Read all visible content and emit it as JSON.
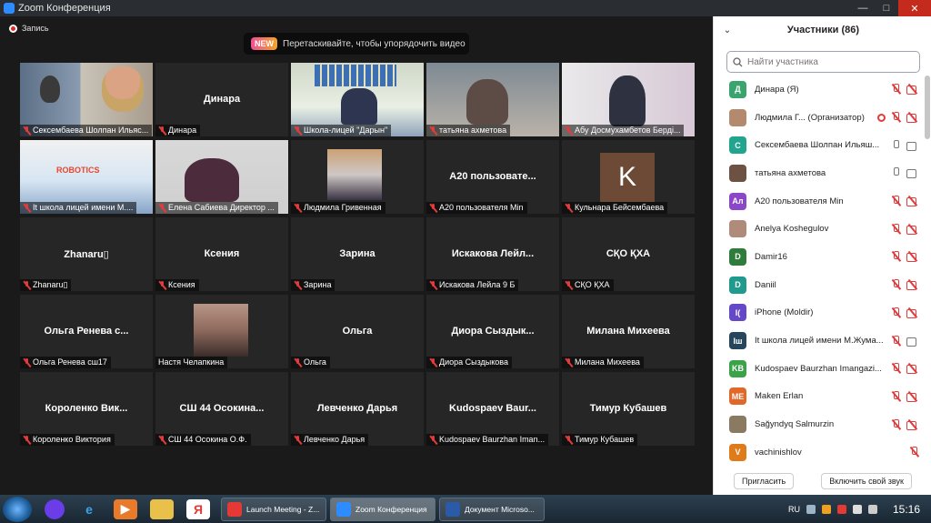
{
  "window": {
    "title": "Zoom Конференция",
    "min": "—",
    "max": "□",
    "close": "✕"
  },
  "recording": {
    "label": "Запись"
  },
  "banner": {
    "badge": "NEW",
    "text": "Перетаскивайте, чтобы упорядочить видео"
  },
  "tiles": [
    {
      "big": "",
      "caption": "Сексембаева Шолпан Ильяс...",
      "kind": "video1",
      "active": true
    },
    {
      "big": "Динара",
      "caption": "Динара",
      "kind": "name"
    },
    {
      "big": "",
      "caption": "Школа-лицей \"Дарын\"",
      "kind": "video3"
    },
    {
      "big": "",
      "caption": "татьяна ахметова",
      "kind": "video4"
    },
    {
      "big": "",
      "caption": "Абу Досмухамбетов Берді...",
      "kind": "video5"
    },
    {
      "big": "",
      "caption": "It школа лицей имени М....",
      "kind": "video6"
    },
    {
      "big": "",
      "caption": "Елена Сабиева Директор ...",
      "kind": "video7"
    },
    {
      "big": "",
      "caption": "Людмила Гривенная",
      "kind": "photo-lg"
    },
    {
      "big": "А20 пользовате...",
      "caption": "А20 пользователя Min",
      "kind": "name"
    },
    {
      "big": "",
      "caption": "Кульнара Бейсембаева",
      "kind": "k"
    },
    {
      "big": "Zhanaru▯",
      "caption": "Zhanaru▯",
      "kind": "name"
    },
    {
      "big": "Ксения",
      "caption": "Ксения",
      "kind": "name"
    },
    {
      "big": "Зарина",
      "caption": "Зарина",
      "kind": "name"
    },
    {
      "big": "Искакова Лейл...",
      "caption": "Искакова Лейла 9 Б",
      "kind": "name"
    },
    {
      "big": "СҚО ҚХА",
      "caption": "СҚО ҚХА",
      "kind": "name"
    },
    {
      "big": "Ольга Ренева с...",
      "caption": "Ольга Ренева сш17",
      "kind": "name"
    },
    {
      "big": "",
      "caption": "Настя Челапкина",
      "kind": "photo-ns",
      "nomic": true
    },
    {
      "big": "Ольга",
      "caption": "Ольга",
      "kind": "name"
    },
    {
      "big": "Диора Сыздык...",
      "caption": "Диора Сыздыкова",
      "kind": "name"
    },
    {
      "big": "Милана Михеева",
      "caption": "Милана Михеева",
      "kind": "name"
    },
    {
      "big": "Короленко Вик...",
      "caption": "Короленко Виктория",
      "kind": "name"
    },
    {
      "big": "СШ 44 Осокина...",
      "caption": "СШ 44 Осокина О.Ф.",
      "kind": "name"
    },
    {
      "big": "Левченко Дарья",
      "caption": "Левченко Дарья",
      "kind": "name"
    },
    {
      "big": "Kudospaev Baur...",
      "caption": "Kudospaev Baurzhan Iman...",
      "kind": "name"
    },
    {
      "big": "Тимур Кубашев",
      "caption": "Тимур Кубашев",
      "kind": "name"
    }
  ],
  "k_letter": "K",
  "robotics_label": "ROBOTICS",
  "panel": {
    "title": "Участники (86)",
    "chevron": "⌄",
    "search_placeholder": "Найти участника",
    "invite": "Пригласить",
    "unmute": "Включить свой звук"
  },
  "participants": [
    {
      "initials": "Д",
      "color": "#3aa46e",
      "name": "Динара (Я)",
      "mic": "off",
      "cam": "off"
    },
    {
      "initials": "",
      "color": "#b48a6e",
      "name": "Людмила Г... (Организатор)",
      "mic": "off",
      "cam": "off",
      "rec": true
    },
    {
      "initials": "С",
      "color": "#22a58e",
      "name": "Сексембаева Шолпан Ильяш...",
      "mic": "on",
      "cam": "on"
    },
    {
      "initials": "",
      "color": "#6d5244",
      "name": "татьяна ахметова",
      "mic": "on",
      "cam": "on"
    },
    {
      "initials": "Ал",
      "color": "#8c46c8",
      "name": "А20 пользователя Min",
      "mic": "off",
      "cam": "off"
    },
    {
      "initials": "",
      "color": "#b08b7a",
      "name": "Anelya Koshegulov",
      "mic": "off",
      "cam": "off"
    },
    {
      "initials": "D",
      "color": "#2f7d3a",
      "name": "Damir16",
      "mic": "off",
      "cam": "off"
    },
    {
      "initials": "D",
      "color": "#1f9a8d",
      "name": "Daniil",
      "mic": "off",
      "cam": "off"
    },
    {
      "initials": "I(",
      "color": "#6448c8",
      "name": "iPhone (Moldir)",
      "mic": "off",
      "cam": "off"
    },
    {
      "initials": "Iш",
      "color": "#26465e",
      "name": "It школа лицей имени М.Жума...",
      "mic": "off",
      "cam": "on"
    },
    {
      "initials": "KB",
      "color": "#3aa34a",
      "name": "Kudospaev Baurzhan Imangazi...",
      "mic": "off",
      "cam": "off"
    },
    {
      "initials": "ME",
      "color": "#e0692a",
      "name": "Maken Erlan",
      "mic": "off",
      "cam": "off"
    },
    {
      "initials": "",
      "color": "#8a7a62",
      "name": "Sağyndyq Salmurzin",
      "mic": "off",
      "cam": "off"
    },
    {
      "initials": "V",
      "color": "#e07b1a",
      "name": "vachinishlov",
      "mic": "off",
      "cam": "none"
    }
  ],
  "taskbar": {
    "tasks": [
      {
        "label": "Launch Meeting - Z...",
        "color": "#e53935",
        "active": false
      },
      {
        "label": "Zoom Конференция",
        "color": "#2d8cff",
        "active": true
      },
      {
        "label": "Документ Microso...",
        "color": "#2b5aa8",
        "active": false
      }
    ],
    "lang": "RU",
    "time": "15:16"
  }
}
